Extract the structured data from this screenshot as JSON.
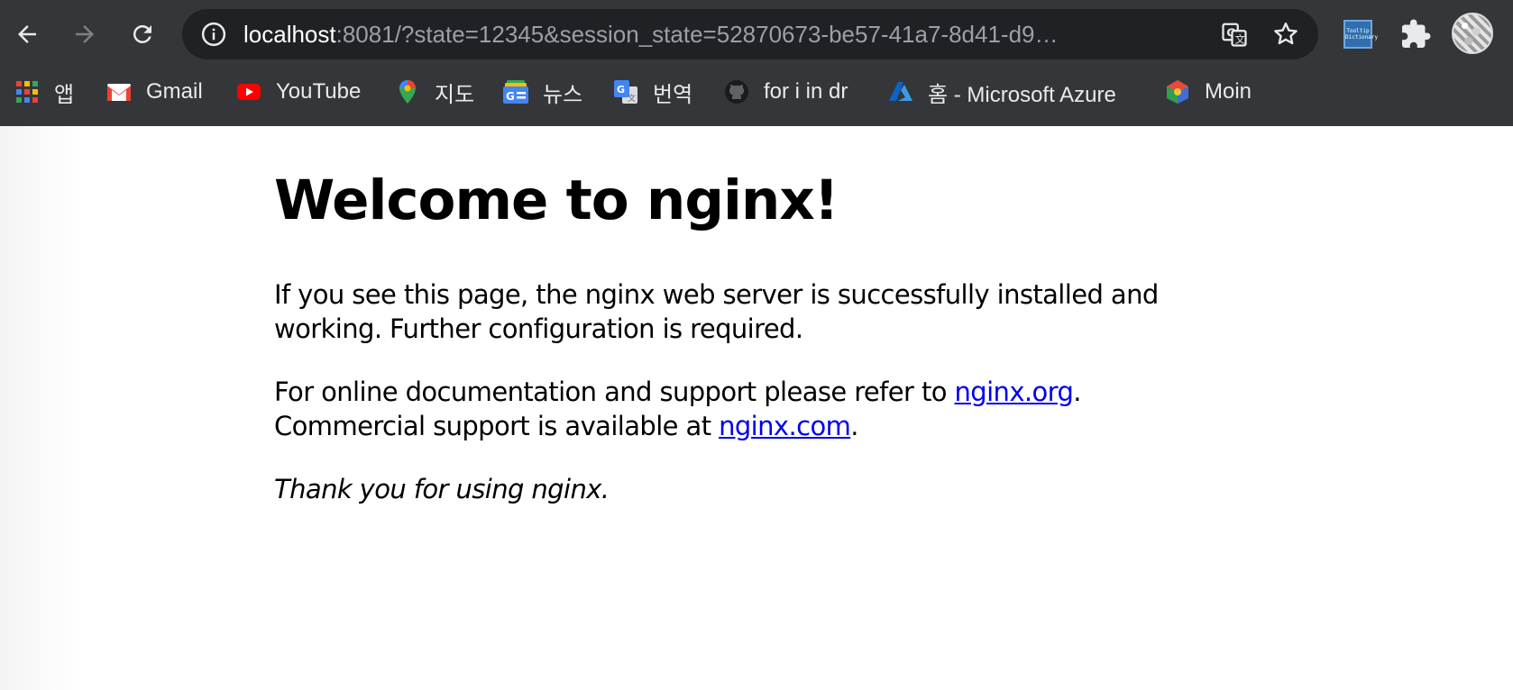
{
  "browser": {
    "url_host": "localhost",
    "url_rest": ":8081/?state=12345&session_state=52870673-be57-41a7-8d41-d9…",
    "extension_tooltip_label_1": "Tooltip",
    "extension_tooltip_label_2": "Dictionary"
  },
  "bookmarks": [
    {
      "label": "앱",
      "icon": "apps-grid-icon"
    },
    {
      "label": "Gmail",
      "icon": "gmail-icon"
    },
    {
      "label": "YouTube",
      "icon": "youtube-icon"
    },
    {
      "label": "지도",
      "icon": "maps-icon"
    },
    {
      "label": "뉴스",
      "icon": "news-icon"
    },
    {
      "label": "번역",
      "icon": "translate-icon"
    },
    {
      "label": "for i in dr",
      "icon": "github-icon"
    },
    {
      "label": "홈 - Microsoft Azure",
      "icon": "azure-icon"
    },
    {
      "label": "Moin",
      "icon": "moin-icon"
    }
  ],
  "page": {
    "heading": "Welcome to nginx!",
    "para1": "If you see this page, the nginx web server is successfully installed and working. Further configuration is required.",
    "para2_prefix": "For online documentation and support please refer to ",
    "para2_link": "nginx.org",
    "para2_suffix": ".",
    "para3_prefix": "Commercial support is available at ",
    "para3_link": "nginx.com",
    "para3_suffix": ".",
    "thanks": "Thank you for using nginx."
  },
  "colors": {
    "chrome_bg": "#35363a",
    "omnibox_bg": "#202124",
    "link": "#0000ee"
  }
}
